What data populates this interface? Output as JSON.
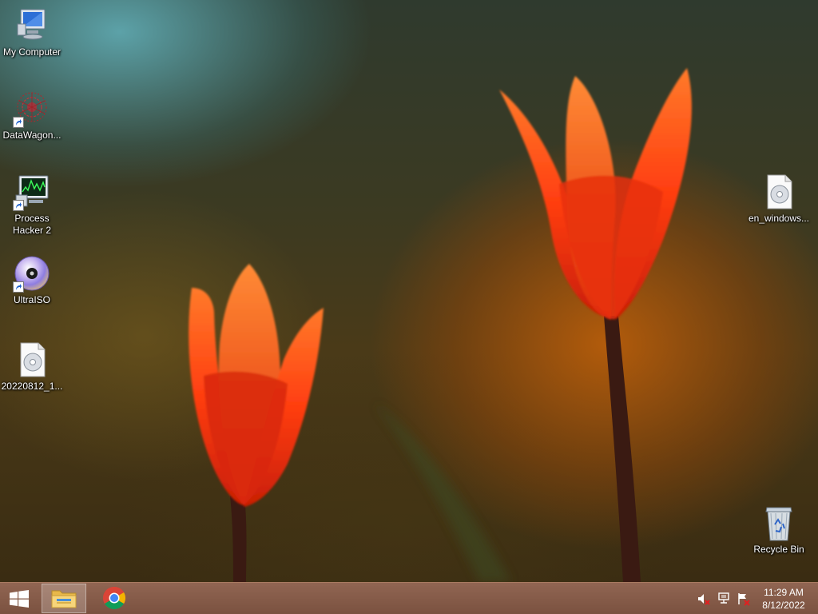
{
  "desktop": {
    "icons": [
      {
        "label": "My Computer",
        "icon": "computer-icon"
      },
      {
        "label": "DataWagon...",
        "icon": "datawagon-icon"
      },
      {
        "label": "Process Hacker 2",
        "icon": "process-hacker-icon"
      },
      {
        "label": "UltraISO",
        "icon": "ultraiso-icon"
      },
      {
        "label": "20220812_1...",
        "icon": "iso-file-icon"
      },
      {
        "label": "en_windows...",
        "icon": "iso-file-icon"
      },
      {
        "label": "Recycle Bin",
        "icon": "recycle-bin-icon"
      }
    ]
  },
  "taskbar": {
    "start": "windows-logo-icon",
    "pinned": [
      {
        "name": "File Explorer",
        "icon": "file-explorer-icon",
        "active": true
      },
      {
        "name": "Google Chrome",
        "icon": "chrome-icon",
        "active": false
      }
    ],
    "tray": [
      "speaker-muted-icon",
      "network-icon",
      "action-center-flag-icon"
    ],
    "clock": {
      "time": "11:29 AM",
      "date": "8/12/2022"
    }
  },
  "colors": {
    "taskbar": "#8a5c48",
    "tulip": "#ff4a12"
  }
}
